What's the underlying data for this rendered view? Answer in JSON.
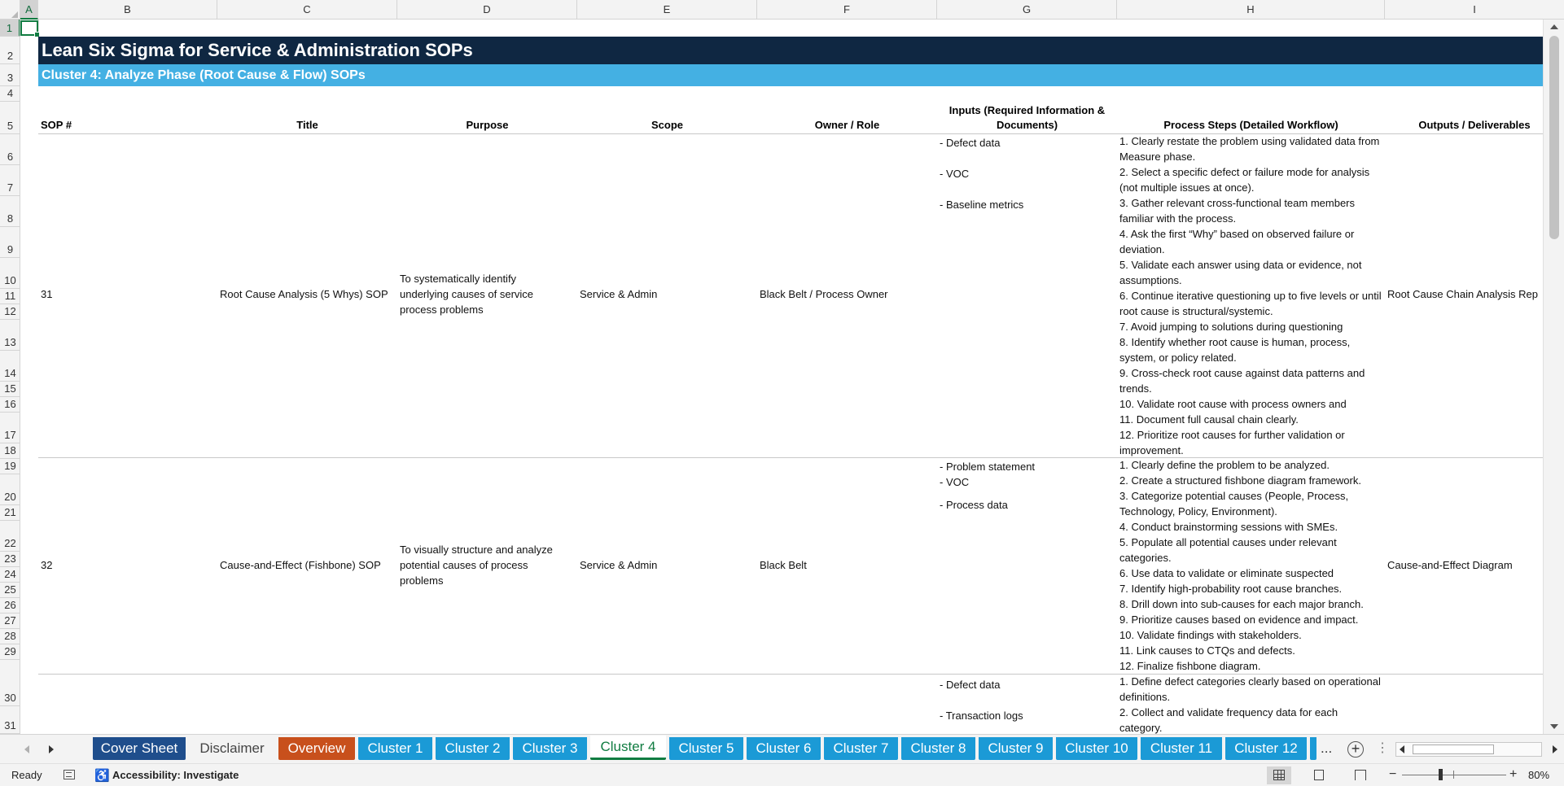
{
  "columns": [
    "A",
    "B",
    "C",
    "D",
    "E",
    "F",
    "G",
    "H",
    "I"
  ],
  "rows": [
    "1",
    "2",
    "3",
    "4",
    "5",
    "6",
    "7",
    "8",
    "9",
    "10",
    "11",
    "12",
    "13",
    "14",
    "15",
    "16",
    "17",
    "18",
    "19",
    "20",
    "21",
    "22",
    "23",
    "24",
    "25",
    "26",
    "27",
    "28",
    "29",
    "30",
    "31"
  ],
  "sheet": {
    "title": "Lean Six Sigma for Service & Administration SOPs",
    "subtitle": "Cluster 4: Analyze Phase (Root Cause & Flow) SOPs",
    "headers": {
      "sop": "SOP #",
      "title": "Title",
      "purpose": "Purpose",
      "scope": "Scope",
      "owner": "Owner / Role",
      "inputs": "Inputs (Required Information & Documents)",
      "steps": "Process Steps (Detailed Workflow)",
      "outputs": "Outputs / Deliverables"
    },
    "records": [
      {
        "sop": "31",
        "title": "Root Cause Analysis (5 Whys) SOP",
        "purpose": "To systematically identify underlying causes of service process problems",
        "scope": "Service & Admin",
        "owner": "Black Belt / Process Owner",
        "inputs": [
          "- Defect data",
          "- VOC",
          "- Baseline metrics"
        ],
        "steps": [
          "1. Clearly restate the problem using validated data from Measure phase.",
          "2. Select a specific defect or failure mode for analysis (not multiple issues at once).",
          "3. Gather relevant cross-functional team members familiar with the process.",
          "4. Ask the first “Why” based on observed failure or deviation.",
          "5. Validate each answer using data or evidence, not assumptions.",
          "6. Continue iterative questioning up to five levels or until root cause is structural/systemic.",
          "7. Avoid jumping to solutions during questioning",
          "8. Identify whether root cause is human, process, system, or policy related.",
          "9. Cross-check root cause against data patterns and trends.",
          "10. Validate root cause with process owners and",
          "11. Document full causal chain clearly.",
          "12. Prioritize root causes for further validation or improvement."
        ],
        "outputs": "Root Cause Chain Analysis Rep"
      },
      {
        "sop": "32",
        "title": "Cause-and-Effect (Fishbone) SOP",
        "purpose": "To visually structure and analyze potential causes of process problems",
        "scope": "Service & Admin",
        "owner": "Black Belt",
        "inputs": [
          "- Problem statement",
          "- VOC",
          "- Process data"
        ],
        "steps": [
          "1. Clearly define the problem to be analyzed.",
          "2. Create a structured fishbone diagram framework.",
          "3. Categorize potential causes (People, Process, Technology, Policy, Environment).",
          "4. Conduct brainstorming sessions with SMEs.",
          "5. Populate all potential causes under relevant categories.",
          "6. Use data to validate or eliminate suspected",
          "7. Identify high-probability root cause branches.",
          "8. Drill down into sub-causes for each major branch.",
          "9. Prioritize causes based on evidence and impact.",
          "10. Validate findings with stakeholders.",
          "11. Link causes to CTQs and defects.",
          "12. Finalize fishbone diagram."
        ],
        "outputs": "Cause-and-Effect Diagram"
      },
      {
        "sop": "",
        "title": "",
        "purpose": "",
        "scope": "",
        "owner": "",
        "inputs": [
          "- Defect data",
          "- Transaction logs"
        ],
        "steps": [
          "1. Define defect categories clearly based on operational definitions.",
          "2. Collect and validate frequency data for each category."
        ],
        "outputs": ""
      }
    ]
  },
  "tabs": [
    {
      "label": "Cover Sheet",
      "color": "#1f4e8c"
    },
    {
      "label": "Disclaimer",
      "color": "#f3f3f3"
    },
    {
      "label": "Overview",
      "color": "#c8501c"
    },
    {
      "label": "Cluster 1",
      "color": "#1b9ad6"
    },
    {
      "label": "Cluster 2",
      "color": "#1b9ad6"
    },
    {
      "label": "Cluster 3",
      "color": "#1b9ad6"
    },
    {
      "label": "Cluster 4",
      "color": "#ffffff",
      "active": true
    },
    {
      "label": "Cluster 5",
      "color": "#1b9ad6"
    },
    {
      "label": "Cluster 6",
      "color": "#1b9ad6"
    },
    {
      "label": "Cluster 7",
      "color": "#1b9ad6"
    },
    {
      "label": "Cluster 8",
      "color": "#1b9ad6"
    },
    {
      "label": "Cluster 9",
      "color": "#1b9ad6"
    },
    {
      "label": "Cluster 10",
      "color": "#1b9ad6"
    },
    {
      "label": "Cluster 11",
      "color": "#1b9ad6"
    },
    {
      "label": "Cluster 12",
      "color": "#1b9ad6"
    }
  ],
  "tabbar": {
    "more": "...",
    "add": "+",
    "kebab": "⋮"
  },
  "status": {
    "ready": "Ready",
    "accessibility": "Accessibility: Investigate",
    "zoom": "80%",
    "zoom_minus": "−",
    "zoom_plus": "+"
  },
  "icons": {
    "accessibility": "accessibility-icon",
    "macro": "macro-recording-icon",
    "normal_view": "normal-view-icon",
    "page_layout": "page-layout-icon",
    "page_break": "page-break-preview-icon"
  },
  "colors": {
    "title_bg": "#0f2742",
    "subtitle_bg": "#44b0e3",
    "accent": "#107c41"
  }
}
